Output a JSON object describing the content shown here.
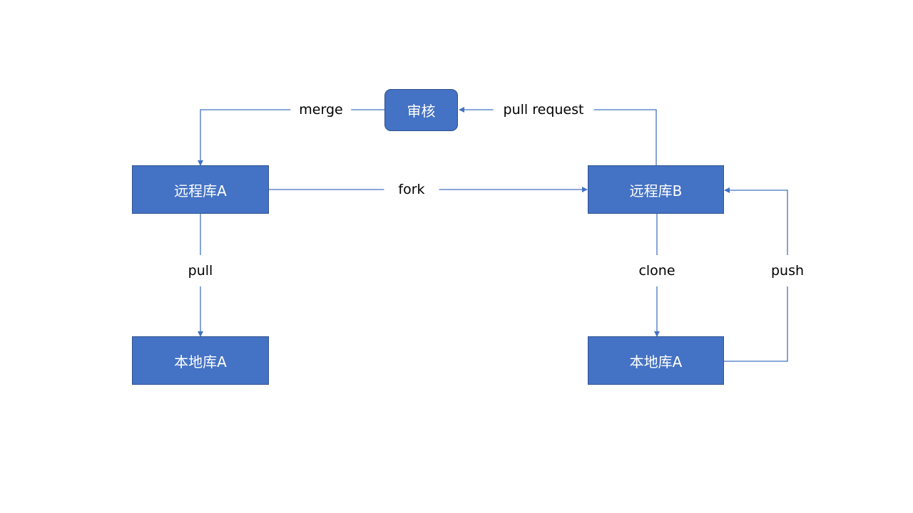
{
  "colors": {
    "node_fill": "#4472c4",
    "node_border": "#2f528f",
    "connector": "#4472c4",
    "label_text": "#000000",
    "background": "#ffffff"
  },
  "nodes": {
    "review": "审核",
    "remote_a": "远程库A",
    "remote_b": "远程库B",
    "local_a_left": "本地库A",
    "local_a_right": "本地库A"
  },
  "edges": {
    "merge": "merge",
    "pull_request": "pull request",
    "fork": "fork",
    "pull": "pull",
    "clone": "clone",
    "push": "push"
  }
}
